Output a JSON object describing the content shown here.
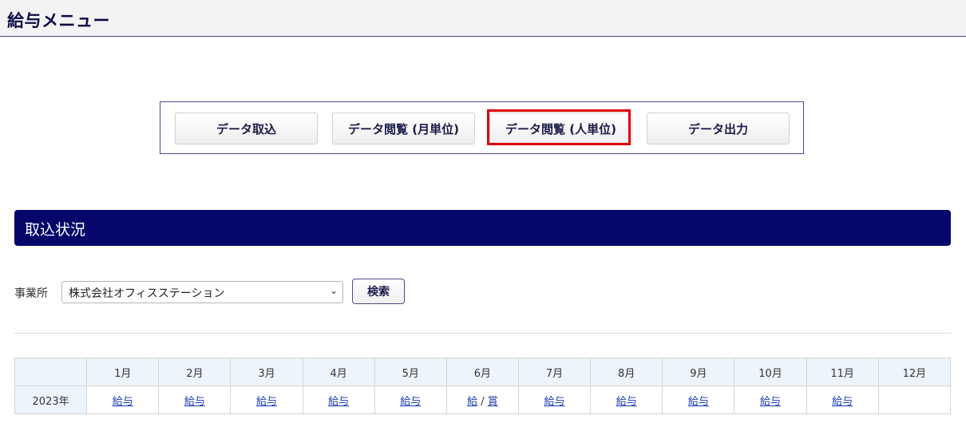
{
  "header": {
    "title": "給与メニュー"
  },
  "menu": {
    "buttons": [
      {
        "label": "データ取込"
      },
      {
        "label": "データ閲覧 (月単位)"
      },
      {
        "label": "データ閲覧 (人単位)"
      },
      {
        "label": "データ出力"
      }
    ],
    "highlighted_index": 2,
    "highlight_color": "#e00000"
  },
  "section": {
    "title": "取込状況",
    "bar_color": "#05056a"
  },
  "filter": {
    "office_label": "事業所",
    "office_selected": "株式会社オフィスステーション",
    "search_label": "検索"
  },
  "table": {
    "months": [
      "1月",
      "2月",
      "3月",
      "4月",
      "5月",
      "6月",
      "7月",
      "8月",
      "9月",
      "10月",
      "11月",
      "12月"
    ],
    "rows": [
      {
        "year": "2023年",
        "cells": [
          "給与",
          "給与",
          "給与",
          "給与",
          "給与",
          "給/賞",
          "給与",
          "給与",
          "給与",
          "給与",
          "給与",
          ""
        ],
        "june": {
          "pay": "給",
          "sep": "/",
          "bonus": "賞"
        }
      }
    ]
  }
}
